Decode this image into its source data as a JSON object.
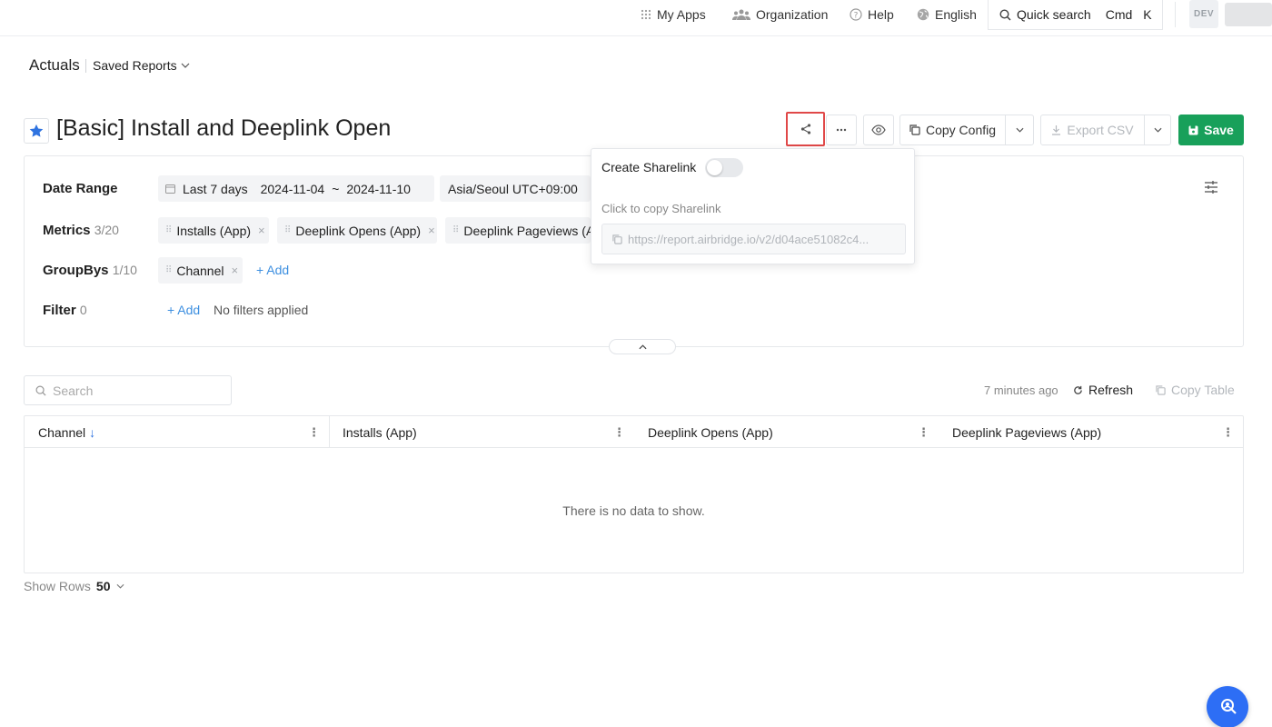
{
  "topbar": {
    "my_apps": "My Apps",
    "organization": "Organization",
    "help": "Help",
    "language": "English",
    "quick_search": "Quick search",
    "shortcut_mod": "Cmd",
    "shortcut_key": "K",
    "env_badge": "DEV"
  },
  "breadcrumb": {
    "section": "Actuals",
    "saved_reports": "Saved Reports"
  },
  "report": {
    "title": "[Basic] Install and Deeplink Open",
    "starred": true
  },
  "toolbar": {
    "copy_config": "Copy Config",
    "export_csv": "Export CSV",
    "save": "Save",
    "save_color": "#18a05a"
  },
  "config": {
    "date_range_label": "Date Range",
    "date_preset": "Last 7 days",
    "date_start": "2024-11-04",
    "date_tilde": "~",
    "date_end": "2024-11-10",
    "timezone": "Asia/Seoul UTC+09:00",
    "metrics_label": "Metrics",
    "metrics_count": "3/20",
    "metrics": [
      "Installs (App)",
      "Deeplink Opens (App)",
      "Deeplink Pageviews (App)"
    ],
    "groupbys_label": "GroupBys",
    "groupbys_count": "1/10",
    "groupbys": [
      "Channel"
    ],
    "add_label": "+ Add",
    "filter_label": "Filter",
    "filter_count": "0",
    "no_filters": "No filters applied"
  },
  "sharelink": {
    "title": "Create Sharelink",
    "enabled": false,
    "hint": "Click to copy Sharelink",
    "url": "https://report.airbridge.io/v2/d04ace51082c4..."
  },
  "table": {
    "search_placeholder": "Search",
    "updated": "7 minutes ago",
    "refresh": "Refresh",
    "copy_table": "Copy Table",
    "columns": [
      "Channel",
      "Installs (App)",
      "Deeplink Opens (App)",
      "Deeplink Pageviews (App)"
    ],
    "sort_indicator": "↓",
    "empty_message": "There is no data to show.",
    "show_rows_label": "Show Rows",
    "show_rows_value": "50"
  },
  "colors": {
    "accent": "#3d8fe0",
    "highlight_border": "#e04848",
    "fab": "#2d6ef5"
  }
}
